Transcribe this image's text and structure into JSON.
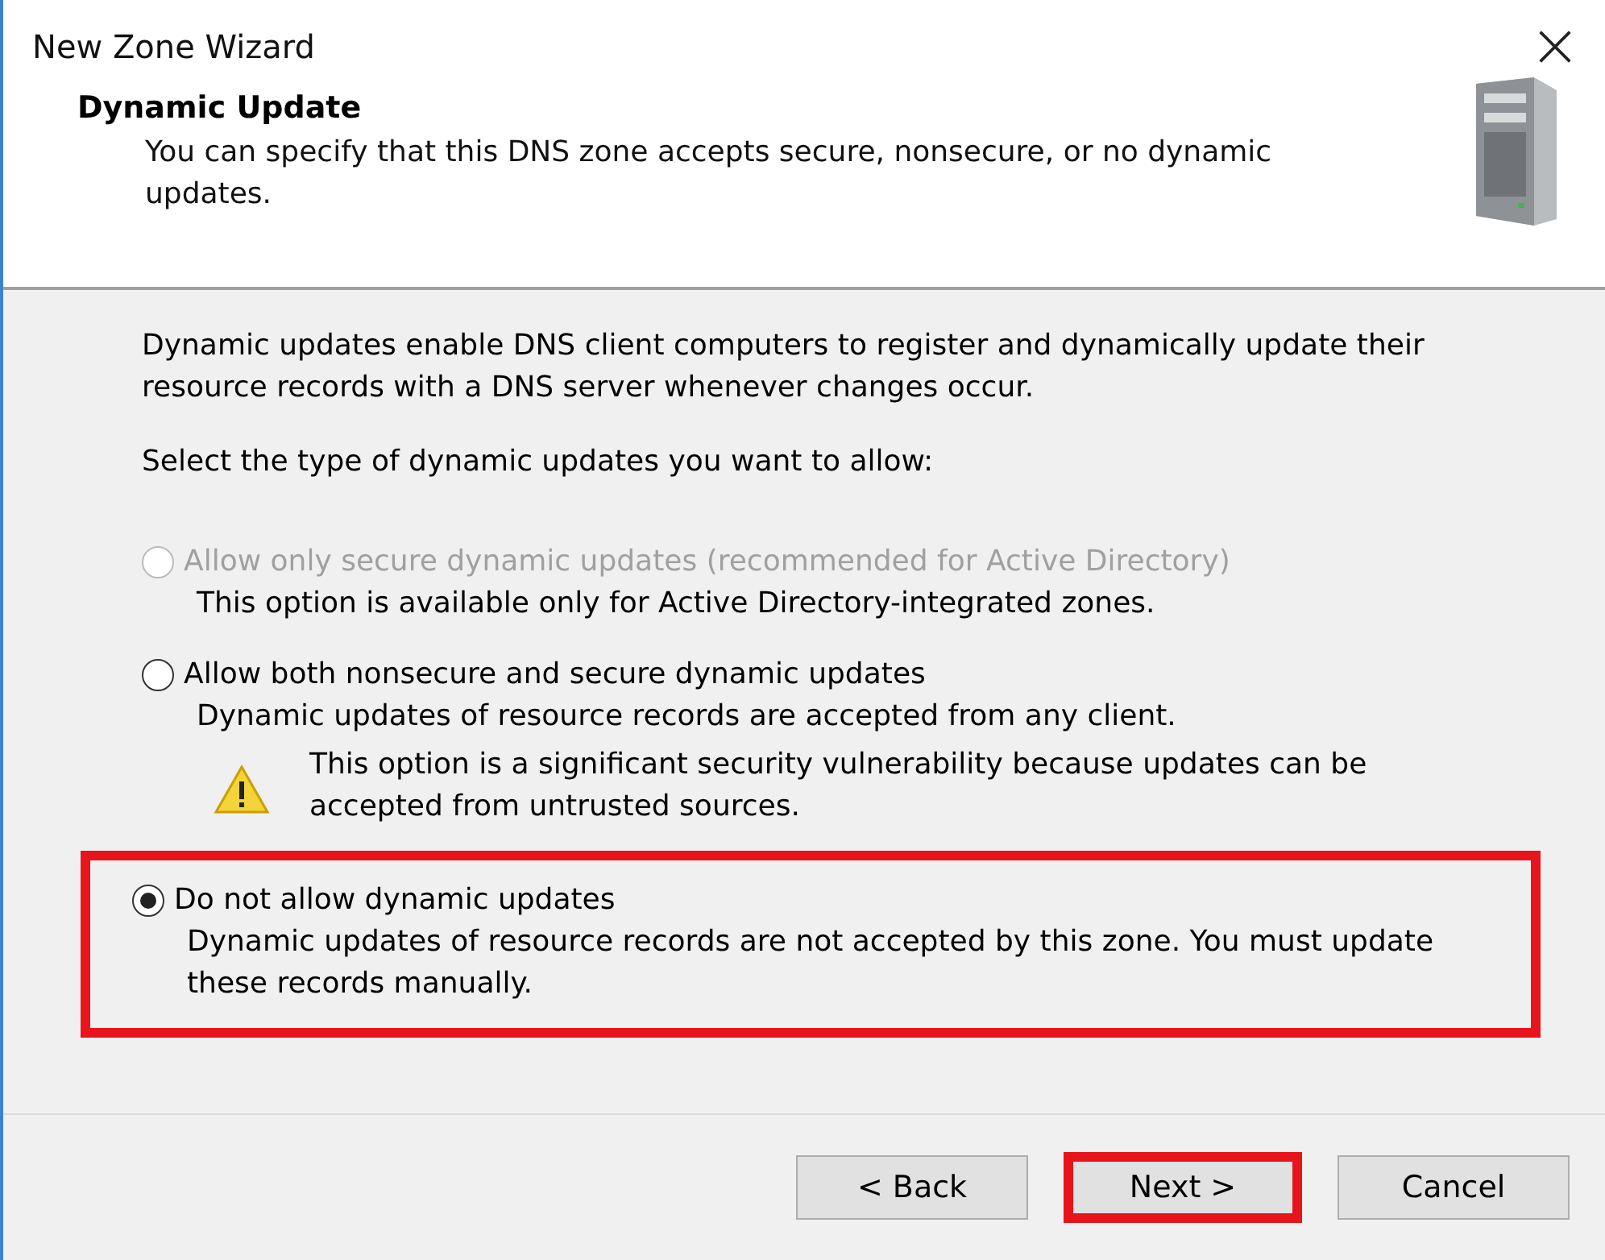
{
  "window": {
    "title": "New Zone Wizard"
  },
  "header": {
    "title": "Dynamic Update",
    "subtitle": "You can specify that this DNS zone accepts secure, nonsecure, or no dynamic updates."
  },
  "intro": "Dynamic updates enable DNS client computers to register and dynamically update their resource records with a DNS server whenever changes occur.",
  "prompt": "Select the type of dynamic updates you want to allow:",
  "options": [
    {
      "label": "Allow only secure dynamic updates (recommended for Active Directory)",
      "description": "This option is available only for Active Directory-integrated zones.",
      "disabled": true,
      "selected": false,
      "highlighted": false
    },
    {
      "label": "Allow both nonsecure and secure dynamic updates",
      "description": "Dynamic updates of resource records are accepted from any client.",
      "warning": "This option is a significant security vulnerability because updates can be accepted from untrusted sources.",
      "disabled": false,
      "selected": false,
      "highlighted": false
    },
    {
      "label": "Do not allow dynamic updates",
      "description": "Dynamic updates of resource records are not accepted by this zone. You must update these records manually.",
      "disabled": false,
      "selected": true,
      "highlighted": true
    }
  ],
  "buttons": [
    {
      "label": "< Back",
      "highlighted": false
    },
    {
      "label": "Next >",
      "highlighted": true
    },
    {
      "label": "Cancel",
      "highlighted": false
    }
  ]
}
